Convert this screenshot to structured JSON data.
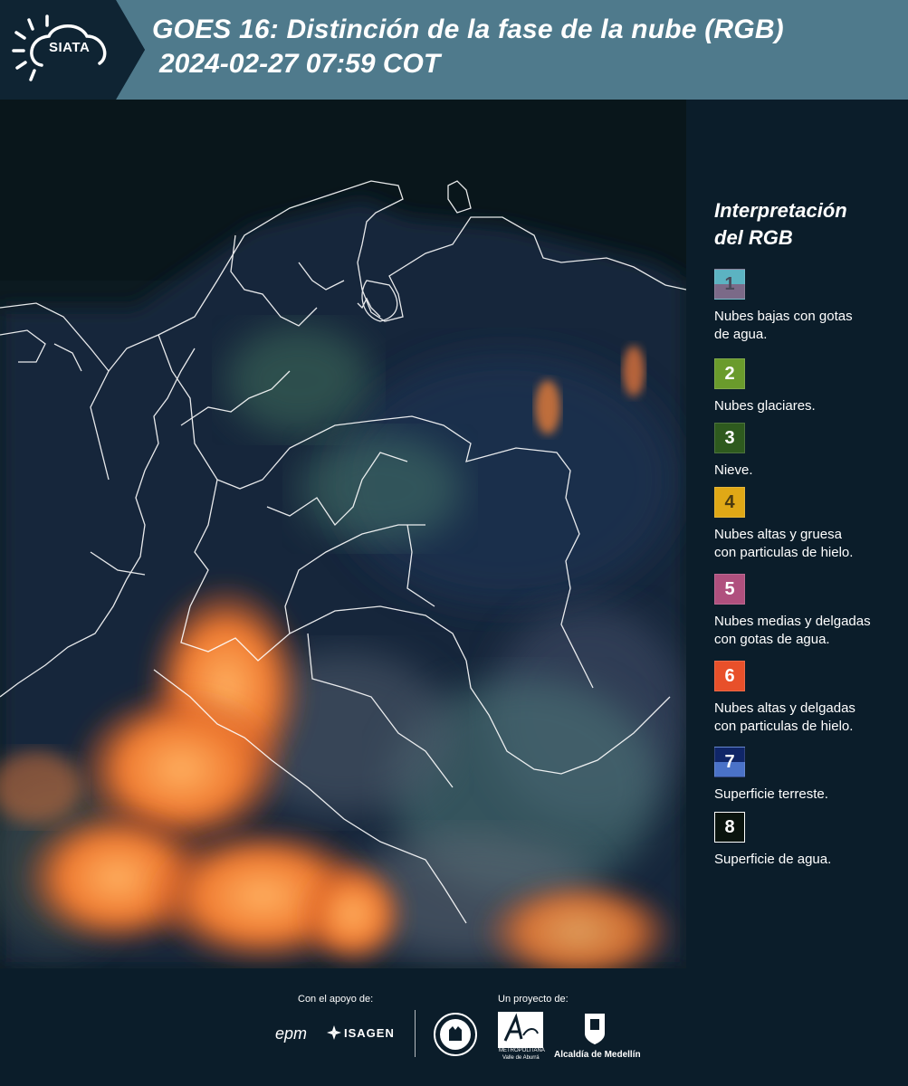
{
  "header": {
    "logo_text": "SIATA",
    "title_line1": "GOES 16: Distinción de la fase de la nube (RGB)",
    "title_line2": "2024-02-27 07:59 COT"
  },
  "legend": {
    "title_line1": "Interpretación",
    "title_line2": "del RGB",
    "items": [
      {
        "num": "1",
        "top_color": "#5cb3c2",
        "bottom_color": "#7b6a88",
        "text_color": "#4a4a5a",
        "text_line1": "Nubes bajas con gotas",
        "text_line2": "de agua."
      },
      {
        "num": "2",
        "top_color": "#6a9b2c",
        "bottom_color": "#6a9b2c",
        "text_color": "#ffffff",
        "text_line1": "Nubes glaciares.",
        "text_line2": ""
      },
      {
        "num": "3",
        "top_color": "#2e5a1e",
        "bottom_color": "#2e5a1e",
        "text_color": "#ffffff",
        "text_line1": "Nieve.",
        "text_line2": ""
      },
      {
        "num": "4",
        "top_color": "#e0a816",
        "bottom_color": "#e0a816",
        "text_color": "#4a3a10",
        "text_line1": "Nubes altas y gruesa",
        "text_line2": "con particulas de hielo."
      },
      {
        "num": "5",
        "top_color": "#b0507e",
        "bottom_color": "#b0507e",
        "text_color": "#ffffff",
        "text_line1": "Nubes medias y delgadas",
        "text_line2": "con gotas de agua."
      },
      {
        "num": "6",
        "top_color": "#e8502a",
        "bottom_color": "#e8502a",
        "text_color": "#ffffff",
        "text_line1": "Nubes altas y delgadas",
        "text_line2": "con particulas de hielo."
      },
      {
        "num": "7",
        "top_color": "#102668",
        "bottom_color": "#4a72c8",
        "text_color": "#ffffff",
        "text_line1": "Superficie terreste.",
        "text_line2": ""
      },
      {
        "num": "8",
        "top_color": "#0a140e",
        "bottom_color": "#0a140e",
        "text_color": "#ffffff",
        "text_line1": "Superficie de agua.",
        "text_line2": ""
      }
    ]
  },
  "footer": {
    "support_label": "Con el apoyo de:",
    "project_label": "Un proyecto de:",
    "epm": "epm",
    "isagen": "ISAGEN",
    "metro_line1": "METROPOLITANA",
    "metro_line2": "Valle de Aburrá",
    "alcaldia": "Alcaldía de Medellín"
  }
}
